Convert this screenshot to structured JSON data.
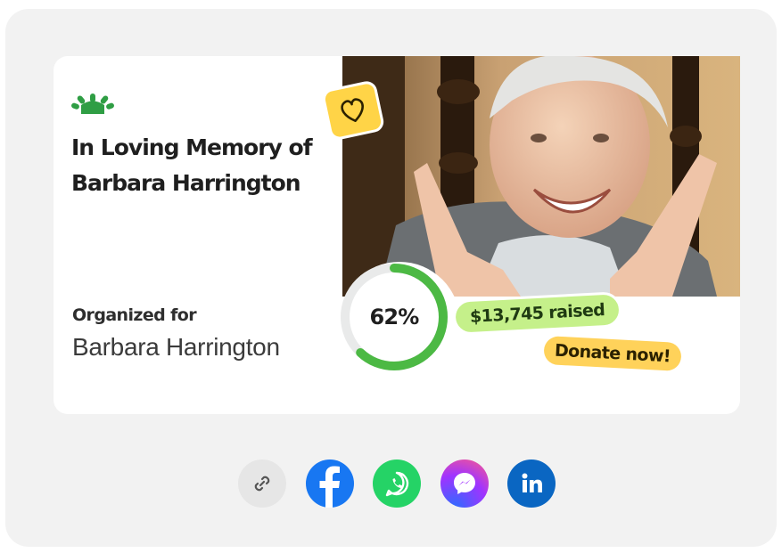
{
  "card": {
    "title": "In Loving Memory of Barbara Harrington",
    "organized_label": "Organized for",
    "organized_name": "Barbara Harrington",
    "logo_icon": "gofundme-sprout-icon",
    "photo_icon": "smiling-elderly-woman-photo",
    "badge_icon": "heart-icon",
    "progress_percent": 62,
    "progress_label": "62%",
    "raised_label": "$13,745 raised",
    "donate_label": "Donate now!"
  },
  "share": [
    {
      "name": "copy-link",
      "icon": "link-icon",
      "color": "#e6e6e6"
    },
    {
      "name": "facebook",
      "icon": "facebook-icon",
      "color": "#1877f2"
    },
    {
      "name": "whatsapp",
      "icon": "whatsapp-icon",
      "color": "#25d366"
    },
    {
      "name": "messenger",
      "icon": "messenger-icon",
      "color": "#a033ff"
    },
    {
      "name": "linkedin",
      "icon": "linkedin-icon",
      "color": "#0a66c2"
    }
  ],
  "colors": {
    "brand_green": "#2f9e44",
    "progress_green": "#4cb944",
    "raised_bg": "#c5f08a",
    "donate_bg": "#ffd25a",
    "heart_bg": "#ffd447"
  }
}
